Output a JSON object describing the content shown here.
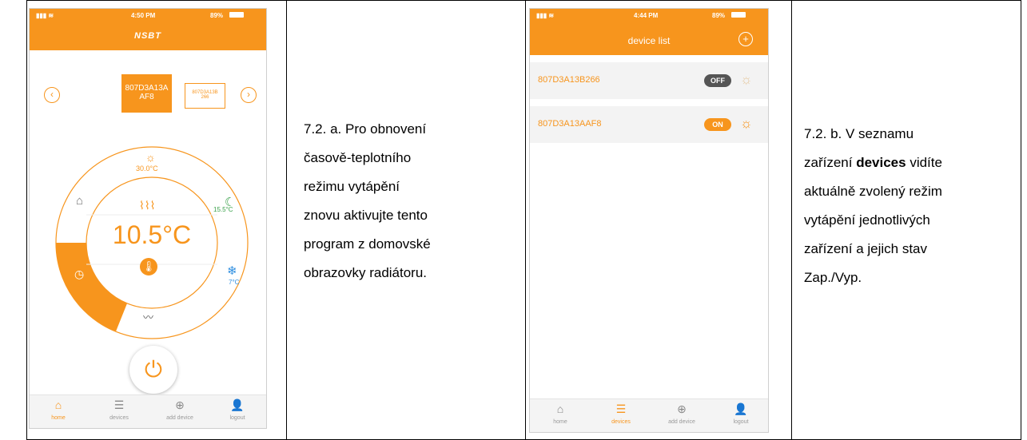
{
  "left_phone": {
    "status": {
      "time": "4:50 PM",
      "battery": "89%"
    },
    "brand": "NSBT",
    "devices": [
      {
        "line1": "807D3A13A",
        "line2": "AF8",
        "selected": true
      },
      {
        "line1": "807D3A13B",
        "line2": "266",
        "selected": false
      }
    ],
    "modes": {
      "comfort": "30.0°C",
      "eco": "15.5°C",
      "antifreeze": "7°C"
    },
    "temperature": "10.5°C",
    "tabs": [
      "home",
      "devices",
      "add device",
      "logout"
    ],
    "active_tab": "home"
  },
  "left_text": [
    "7.2. a. Pro obnovení",
    "časově-teplotního",
    "režimu vytápění",
    "znovu aktivujte tento",
    "program z domovské",
    "obrazovky radiátoru."
  ],
  "right_phone": {
    "status": {
      "time": "4:44 PM",
      "battery": "89%"
    },
    "title": "device list",
    "devices": [
      {
        "name": "807D3A13B266",
        "state": "OFF"
      },
      {
        "name": "807D3A13AAF8",
        "state": "ON"
      }
    ],
    "tabs": [
      "home",
      "devices",
      "add device",
      "logout"
    ],
    "active_tab": "devices"
  },
  "right_text": {
    "line1": "7.2. b. V seznamu",
    "line2_pre": "zařízení ",
    "line2_bold": "devices",
    "line2_post": " vidíte",
    "line3": "aktuálně zvolený režim",
    "line4": "vytápění jednotlivých",
    "line5": "zařízení a jejich stav",
    "line6": "Zap./Vyp."
  },
  "colors": {
    "accent": "#f7951d",
    "eco": "#3aa14a",
    "antifreeze": "#2f8fe0"
  }
}
